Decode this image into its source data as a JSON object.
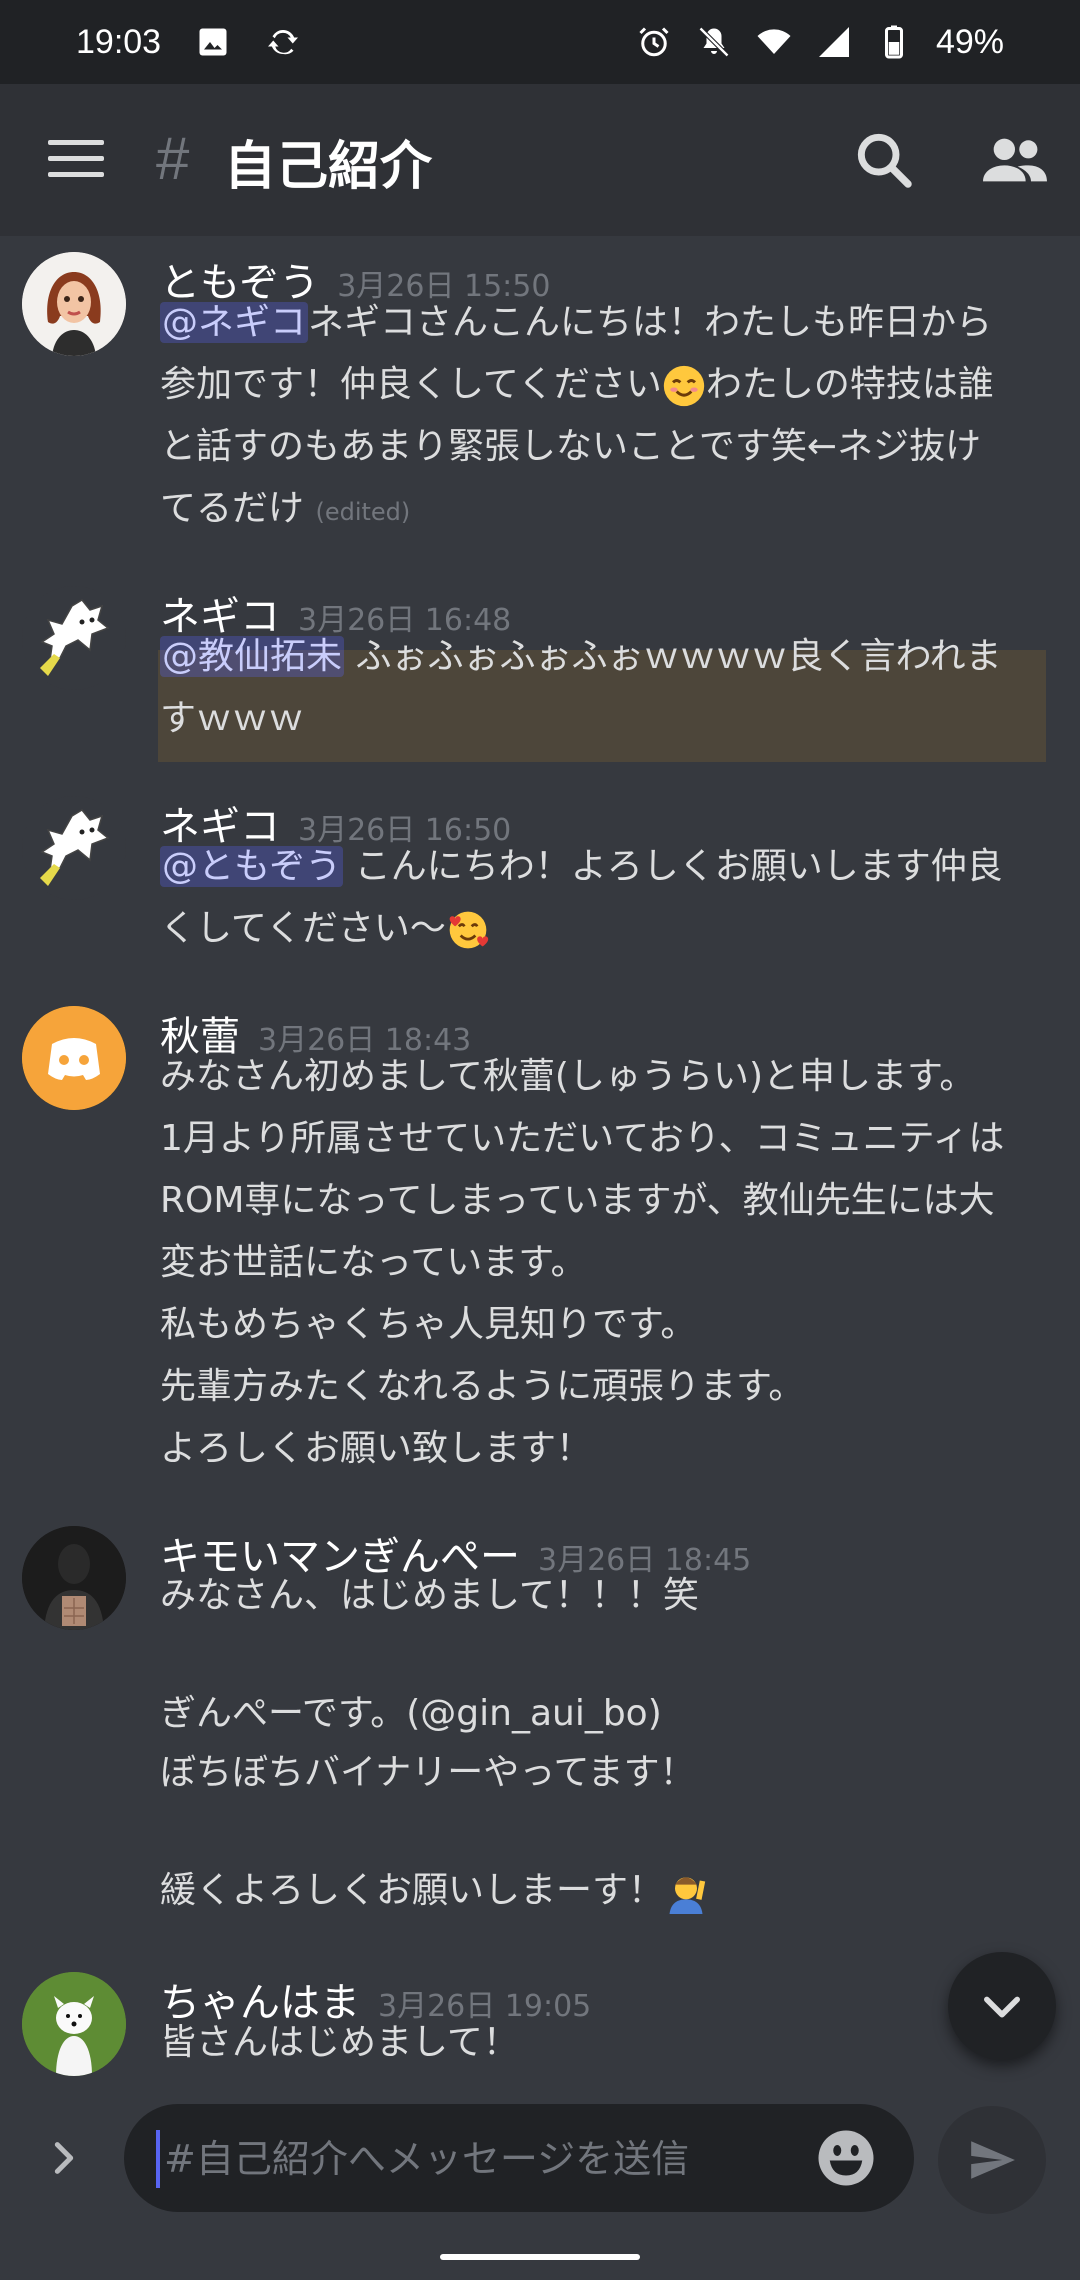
{
  "statusbar": {
    "time": "19:03",
    "battery": "49%"
  },
  "header": {
    "channel_name": "自己紹介",
    "hash": "#"
  },
  "messages": [
    {
      "user": "ともぞう",
      "time": "3月26日 15:50",
      "mention": "@ネギコ",
      "text1": "ネギコさんこんにちは！わたしも昨日から",
      "text2": "参加です！仲良くしてください",
      "text3": "わたしの特技は誰",
      "text4": "と話すのもあまり緊張しないことです笑←ネジ抜け",
      "text5": "てるだけ",
      "edited": "(edited)"
    },
    {
      "user": "ネギコ",
      "time": "3月26日 16:48",
      "mention": "@教仙拓未",
      "text1": " ふぉふぉふぉふぉｗｗｗｗ良く言われま",
      "text2": "すｗｗｗ"
    },
    {
      "user": "ネギコ",
      "time": "3月26日 16:50",
      "mention": "@ともぞう",
      "text1": " こんにちわ！よろしくお願いします仲良",
      "text2": "くしてください〜"
    },
    {
      "user": "秋蕾",
      "time": "3月26日 18:43",
      "lines": [
        "みなさん初めまして秋蕾(しゅうらい)と申します。",
        "1月より所属させていただいており、コミュニティは",
        "ROM専になってしまっていますが、教仙先生には大",
        "変お世話になっています。",
        "私もめちゃくちゃ人見知りです。",
        "先輩方みたくなれるように頑張ります。",
        "よろしくお願い致します！"
      ]
    },
    {
      "user": "キモいマンぎんぺー",
      "time": "3月26日 18:45",
      "lines": [
        "みなさん、はじめまして！！！笑",
        "",
        "ぎんぺーです。(@gin_aui_bo)",
        "ぼちぼちバイナリーやってます！",
        "",
        "緩くよろしくお願いしまーす！"
      ]
    },
    {
      "user": "ちゃんはま",
      "time": "3月26日 19:05",
      "lines": [
        "皆さんはじめまして！"
      ]
    }
  ],
  "composer": {
    "placeholder": "#自己紹介へメッセージを送信"
  },
  "icons": [
    "menu-icon",
    "search-icon",
    "members-icon",
    "chevron-down-icon",
    "chevron-right-icon",
    "emoji-icon",
    "send-icon",
    "alarm-icon",
    "mute-icon",
    "wifi-icon",
    "signal-icon",
    "battery-icon",
    "image-icon",
    "sync-icon"
  ],
  "colors": {
    "background": "#36393f",
    "header": "#2f3136",
    "mention": "#5865f2",
    "highlight": "#faa81a"
  }
}
